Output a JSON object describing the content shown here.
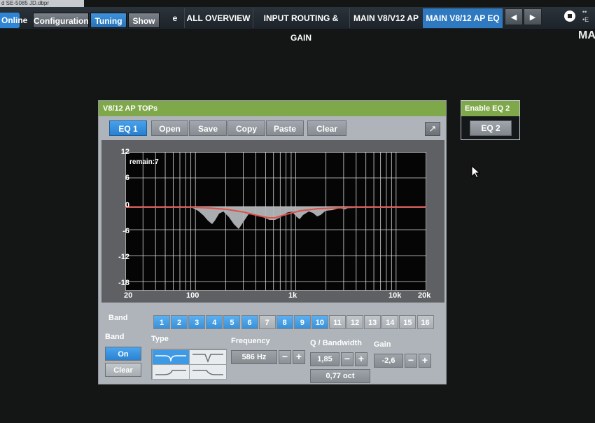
{
  "file_tab": {
    "label": "d SE-5085 JD.dbpr"
  },
  "toolbar": {
    "online_label": "Online",
    "modes": [
      "Configuration",
      "Tuning",
      "Show"
    ],
    "tabs": [
      "e",
      "ALL OVERVIEW",
      "INPUT ROUTING & GAIN",
      "MAIN V8/V12 AP",
      "MAIN V8/12 AP EQ"
    ],
    "nav_prev": "◀",
    "nav_next": "▶",
    "edge_label": "MA",
    "edge_dots": [
      "••",
      "•E"
    ]
  },
  "eq_panel": {
    "title": "V8/12 AP TOPs",
    "buttons": [
      "EQ 1",
      "Open",
      "Save",
      "Copy",
      "Paste",
      "Clear"
    ],
    "expand_icon": "↗",
    "remain": "remain:7",
    "y_ticks": [
      "12",
      "6",
      "0",
      "-6",
      "-12",
      "-18"
    ],
    "x_ticks": [
      "20",
      "100",
      "1k",
      "10k",
      "20k"
    ],
    "band_label": "Band",
    "bands": [
      "1",
      "2",
      "3",
      "4",
      "5",
      "6",
      "7",
      "8",
      "9",
      "10",
      "11",
      "12",
      "13",
      "14",
      "15",
      "16"
    ],
    "active_bands": [
      1,
      2,
      3,
      4,
      5,
      6,
      8,
      9,
      10
    ],
    "controls": {
      "band_label": "Band",
      "on_label": "On",
      "clear_label": "Clear",
      "type_label": "Type",
      "frequency_label": "Frequency",
      "frequency_value": "586 Hz",
      "q_label": "Q / Bandwidth",
      "q_value": "1,85",
      "octave_value": "0,77 oct",
      "gain_label": "Gain",
      "gain_value": "-2,6",
      "minus": "−",
      "plus": "+"
    }
  },
  "eq2_panel": {
    "title": "Enable EQ 2",
    "button": "EQ 2"
  },
  "colors": {
    "accent_blue": "#2e79c0",
    "title_green": "#7fa84a",
    "curve_red": "#e0504a"
  }
}
